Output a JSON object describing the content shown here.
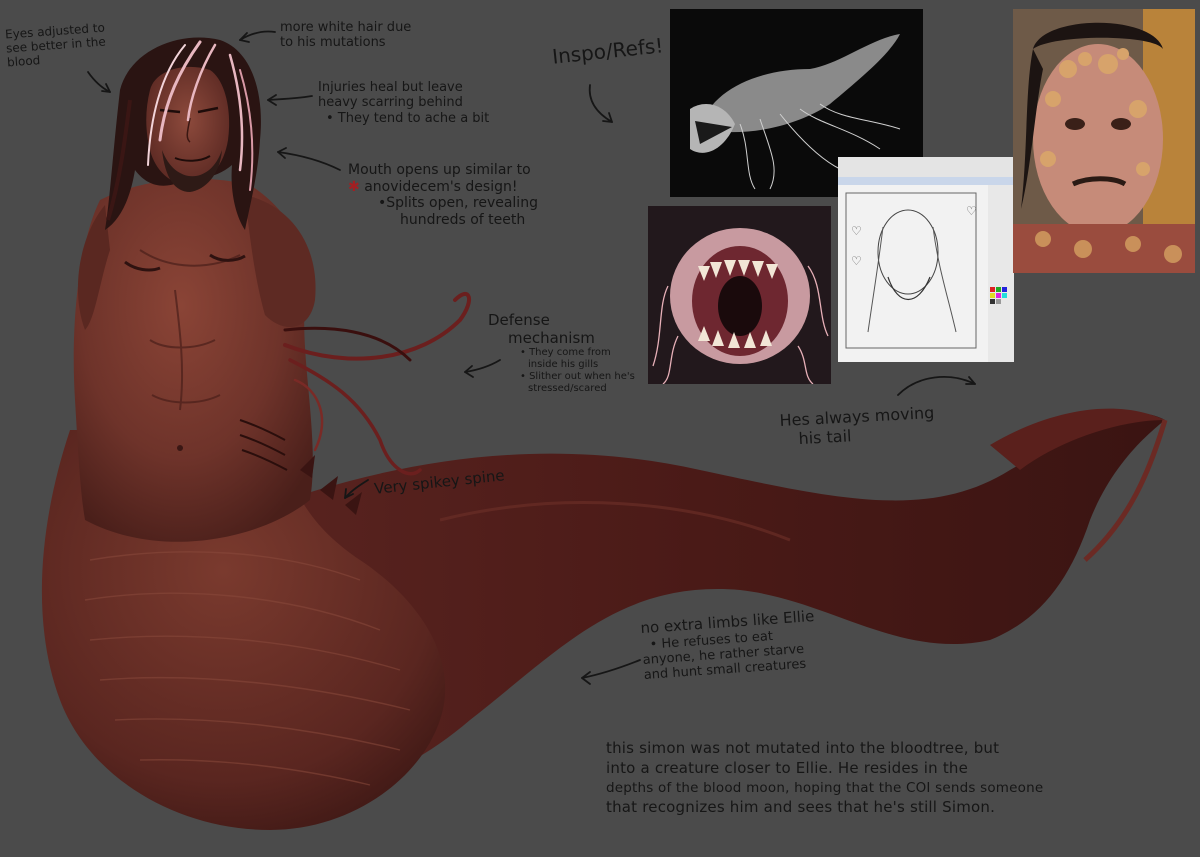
{
  "notes": {
    "eyes": [
      "Eyes adjusted to",
      "see better in the",
      "blood"
    ],
    "hair": [
      "more white hair due",
      "to his mutations"
    ],
    "injuries": [
      "Injuries heal but leave",
      "heavy scarring behind",
      "• They tend to ache a bit"
    ],
    "mouth": [
      "Mouth opens up similar to",
      "anovidecem's design!",
      "•Splits open, revealing",
      "hundreds of teeth"
    ],
    "inspo": "Inspo/Refs!",
    "defense": [
      "Defense",
      "mechanism",
      "• They come from",
      "inside his gills",
      "• Slither out when he's",
      "stressed/scared"
    ],
    "spine": "Very spikey spine",
    "tail": [
      "Hes always moving",
      "his tail"
    ],
    "limbs": [
      "no extra limbs like Ellie",
      "• He refuses to eat",
      "anyone, he rather starve",
      "and hunt small creatures"
    ],
    "summary": [
      "this simon was not mutated into the bloodtree, but",
      "into a creature closer to Ellie. He resides in the",
      "depths of the blood moon, hoping that the COI sends someone",
      "that recognizes him and sees that he's still Simon."
    ]
  },
  "colors": {
    "background": "#4b4b4b",
    "ink": "#161616",
    "accent_asterisk": "#a31f22",
    "skin": "#6e332a",
    "tail": "#4a1a17"
  }
}
